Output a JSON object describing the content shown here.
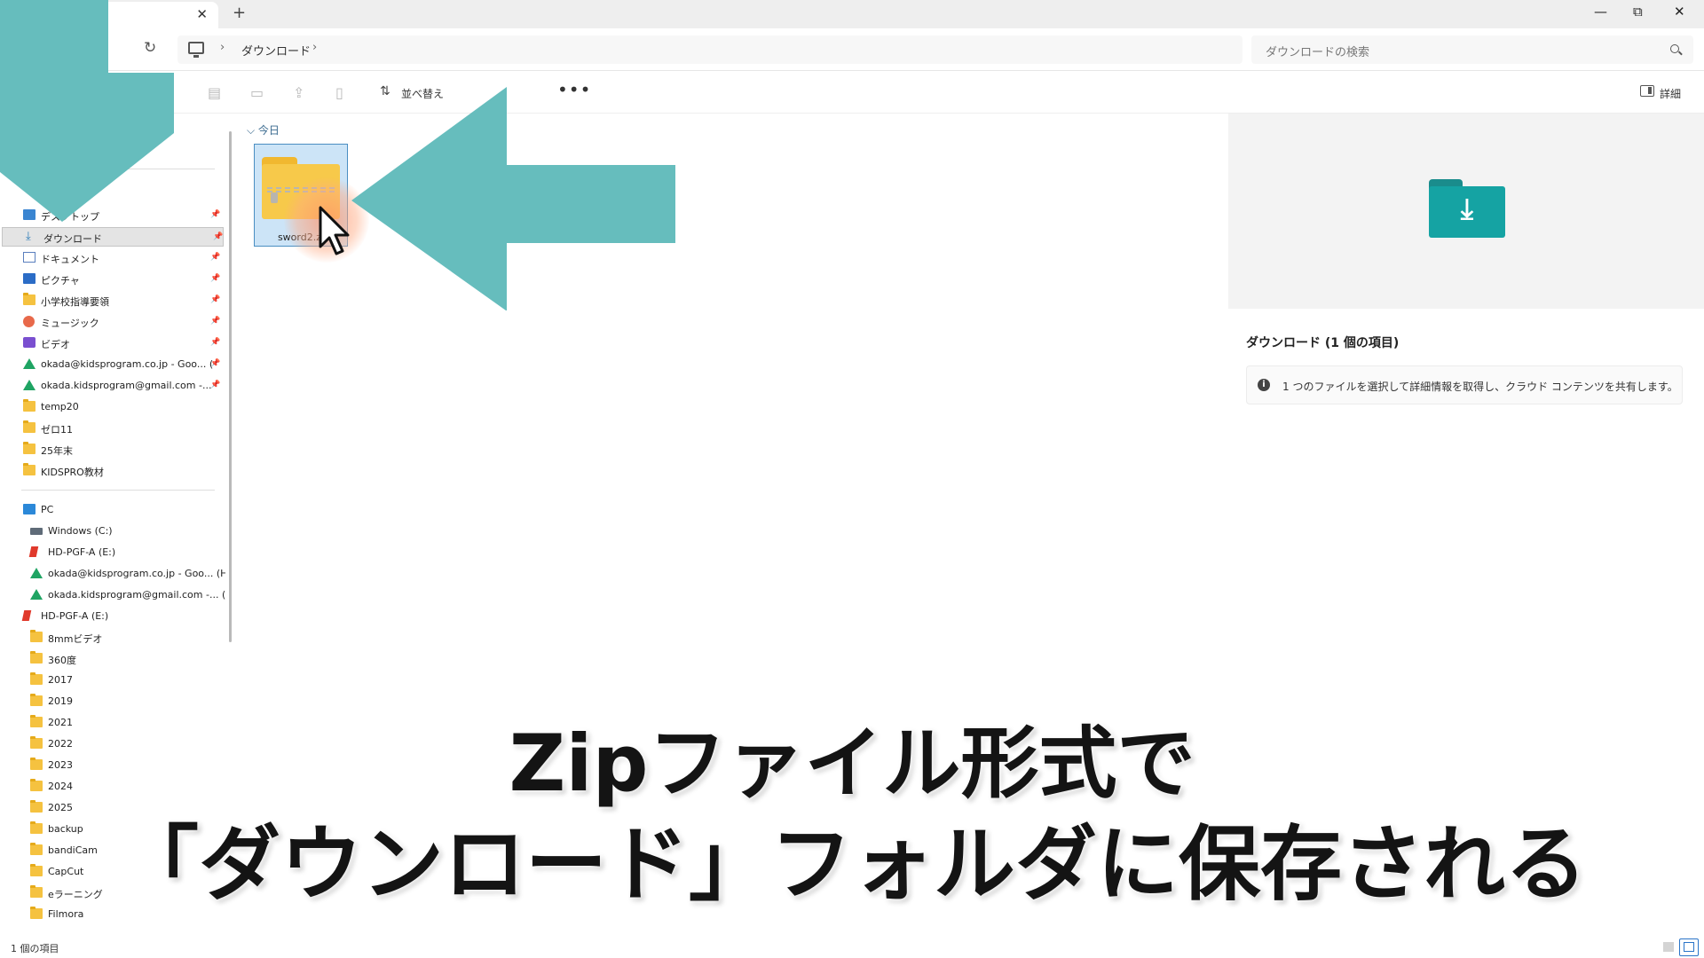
{
  "colors": {
    "accent": "#66bdbd",
    "selection": "#cce4f7",
    "folder": "#f5c240",
    "download_folder": "#15a3a3"
  },
  "titlebar": {
    "close_glyph": "✕",
    "new_tab_glyph": "+",
    "minimize_glyph": "—",
    "restore_glyph": "⧉",
    "window_close_glyph": "✕"
  },
  "addressbar": {
    "back": "←",
    "refresh": "↻",
    "crumb_separator": "›",
    "location": "ダウンロード",
    "search_placeholder": "ダウンロードの検索"
  },
  "commandbar": {
    "sort_prefix": "並べ替え",
    "more": "•••",
    "details_label": "詳細"
  },
  "sidebar": {
    "quick": [
      {
        "label": "デスクトップ",
        "icon": "desktop-icon",
        "pinned": true
      },
      {
        "label": "ダウンロード",
        "icon": "download-icon",
        "pinned": true,
        "selected": true
      },
      {
        "label": "ドキュメント",
        "icon": "document-icon",
        "pinned": true
      },
      {
        "label": "ピクチャ",
        "icon": "pictures-icon",
        "pinned": true
      },
      {
        "label": "小学校指導要領",
        "icon": "folder-icon",
        "pinned": true
      },
      {
        "label": "ミュージック",
        "icon": "music-icon",
        "pinned": true
      },
      {
        "label": "ビデオ",
        "icon": "video-icon",
        "pinned": true
      },
      {
        "label": "okada@kidsprogram.co.jp - Goo... (",
        "icon": "google-drive-icon",
        "pinned": true
      },
      {
        "label": "okada.kidsprogram@gmail.com -...",
        "icon": "google-drive-icon",
        "pinned": true
      },
      {
        "label": "temp20",
        "icon": "folder-icon"
      },
      {
        "label": "ゼロ11",
        "icon": "folder-icon"
      },
      {
        "label": "25年末",
        "icon": "folder-icon"
      },
      {
        "label": "KIDSPRO教材",
        "icon": "folder-icon"
      }
    ],
    "pc": [
      {
        "label": "PC",
        "icon": "pc-icon",
        "indent": 0
      },
      {
        "label": "Windows (C:)",
        "icon": "drive-icon",
        "indent": 1
      },
      {
        "label": "HD-PGF-A (E:)",
        "icon": "hdd-icon",
        "indent": 1
      },
      {
        "label": "okada@kidsprogram.co.jp - Goo... (H",
        "icon": "google-drive-icon",
        "indent": 1
      },
      {
        "label": "okada.kidsprogram@gmail.com -... (I",
        "icon": "google-drive-icon",
        "indent": 1
      },
      {
        "label": "HD-PGF-A (E:)",
        "icon": "hdd-icon",
        "indent": 0
      },
      {
        "label": "8mmビデオ",
        "icon": "folder-icon",
        "indent": 1
      },
      {
        "label": "360度",
        "icon": "folder-icon",
        "indent": 1
      },
      {
        "label": "2017",
        "icon": "folder-icon",
        "indent": 1
      },
      {
        "label": "2019",
        "icon": "folder-icon",
        "indent": 1
      },
      {
        "label": "2021",
        "icon": "folder-icon",
        "indent": 1
      },
      {
        "label": "2022",
        "icon": "folder-icon",
        "indent": 1
      },
      {
        "label": "2023",
        "icon": "folder-icon",
        "indent": 1
      },
      {
        "label": "2024",
        "icon": "folder-icon",
        "indent": 1
      },
      {
        "label": "2025",
        "icon": "folder-icon",
        "indent": 1
      },
      {
        "label": "backup",
        "icon": "folder-icon",
        "indent": 1
      },
      {
        "label": "bandiCam",
        "icon": "folder-icon",
        "indent": 1
      },
      {
        "label": "CapCut",
        "icon": "folder-icon",
        "indent": 1
      },
      {
        "label": "eラーニング",
        "icon": "folder-icon",
        "indent": 1
      },
      {
        "label": "Filmora",
        "icon": "folder-icon",
        "indent": 1
      }
    ]
  },
  "content": {
    "group_header": "今日",
    "file_name": "sword2.zi"
  },
  "preview": {
    "title": "ダウンロード (1 個の項目)",
    "info": "1 つのファイルを選択して詳細情報を取得し、クラウド コンテンツを共有します。"
  },
  "statusbar": {
    "count": "1 個の項目"
  },
  "caption": {
    "line1": "Zipファイル形式で",
    "line2": "「ダウンロード」フォルダに保存される"
  }
}
